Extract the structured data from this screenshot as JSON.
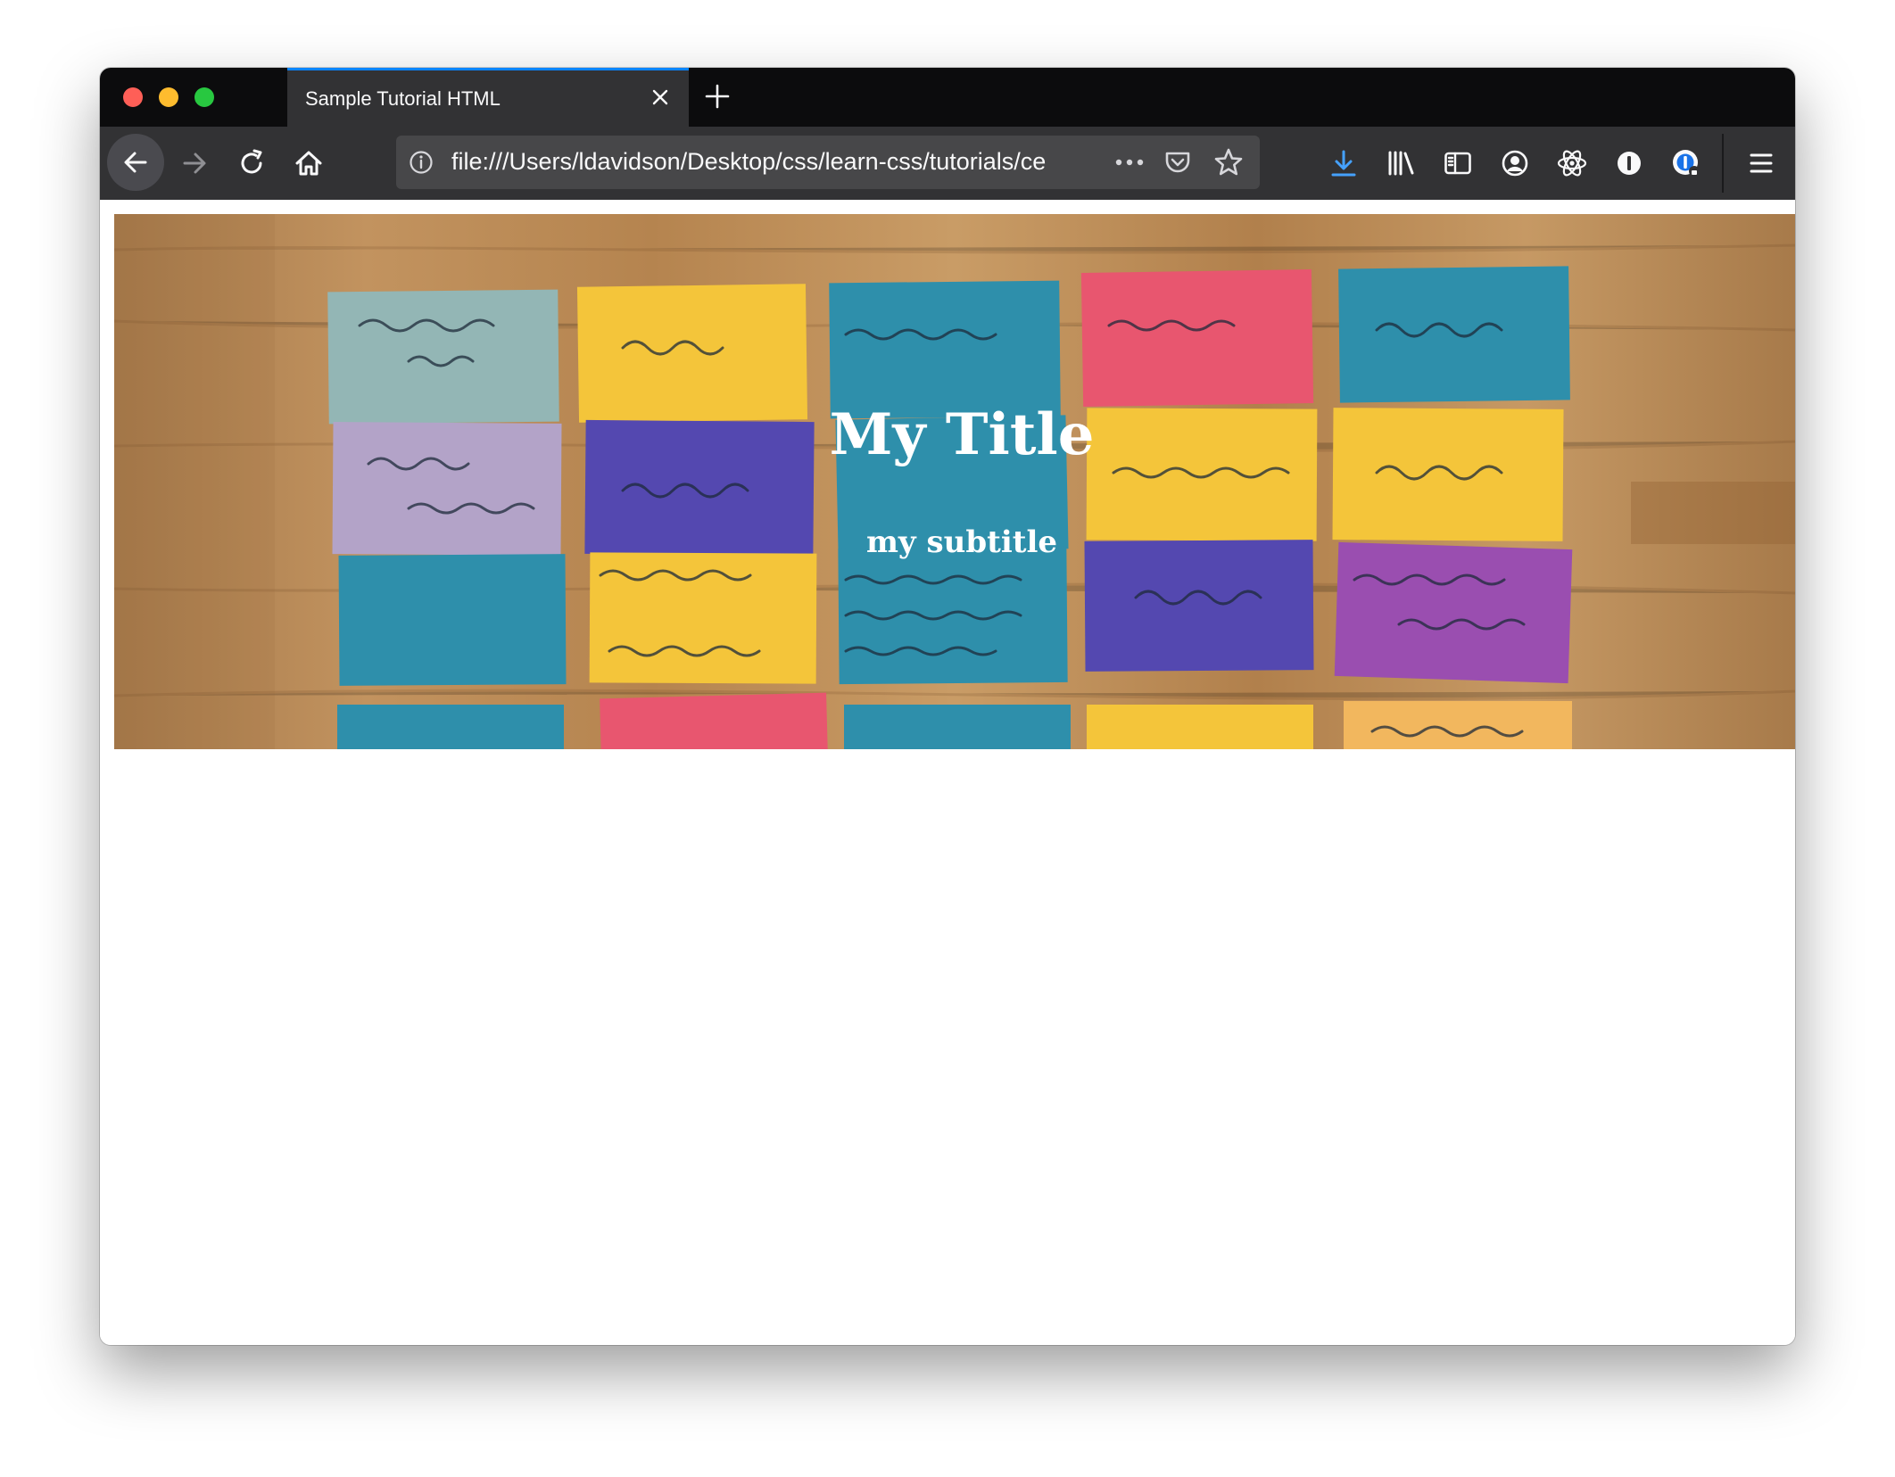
{
  "browser": {
    "tab": {
      "title": "Sample Tutorial HTML"
    },
    "address_bar": {
      "url": "file:///Users/ldavidson/Desktop/css/learn-css/tutorials/ce"
    },
    "toolbar_icons": [
      "back-arrow-icon",
      "forward-arrow-icon",
      "reload-icon",
      "home-icon",
      "info-icon",
      "more-dots-icon",
      "pocket-icon",
      "star-icon",
      "download-icon",
      "library-icon",
      "sidebar-icon",
      "account-icon",
      "react-devtools-icon",
      "privacy-icon",
      "password-manager-icon",
      "menu-icon"
    ],
    "accent_color": "#0a84ff"
  },
  "page": {
    "title": "My Title",
    "subtitle": "my subtitle"
  },
  "colors": {
    "card_teal": "#2e8fab",
    "card_yellow": "#f4c53a",
    "card_purple": "#5448b0",
    "card_pink": "#e8566f",
    "card_lavender": "#b3a3c8",
    "card_sage": "#93b6b5",
    "card_violet": "#9a4eb0",
    "card_orange": "#f2b75e"
  }
}
